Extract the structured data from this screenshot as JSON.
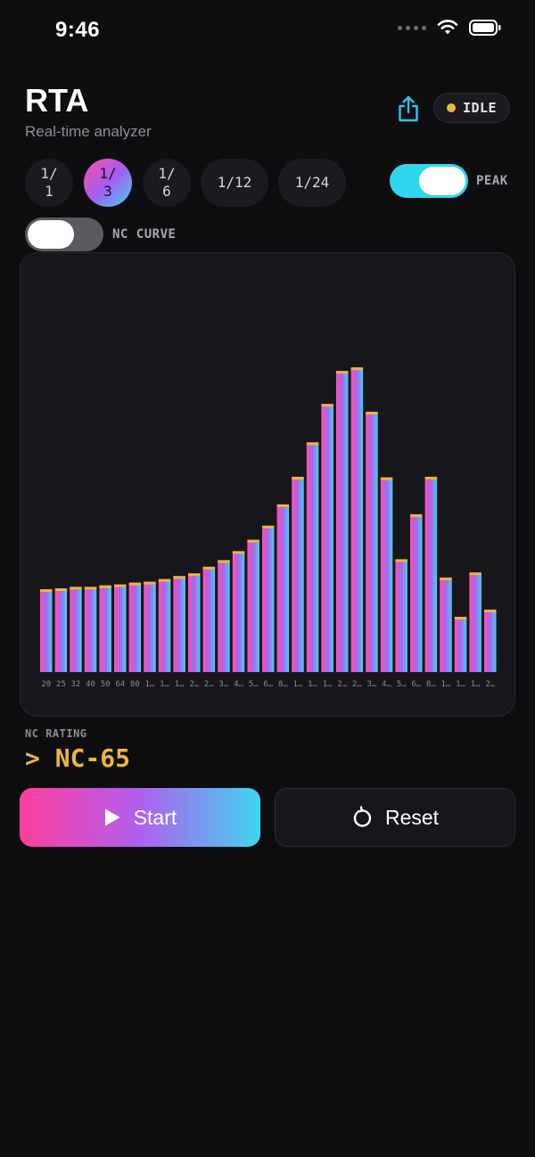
{
  "status_bar": {
    "time": "9:46"
  },
  "header": {
    "title": "RTA",
    "subtitle": "Real-time analyzer",
    "status_badge": "IDLE",
    "badge_color": "#f0b43c"
  },
  "resolution": {
    "options": [
      "1/\n1",
      "1/\n3",
      "1/\n6",
      "1/12",
      "1/24"
    ],
    "selected": "1/\n3"
  },
  "toggles": {
    "peak": {
      "label": "PEAK",
      "on": true
    },
    "nc_curve": {
      "label": "NC CURVE",
      "on": false
    }
  },
  "chart_data": {
    "type": "bar",
    "categories": [
      "20",
      "25",
      "32",
      "40",
      "50",
      "64",
      "80",
      "1…",
      "1…",
      "1…",
      "2…",
      "2…",
      "3…",
      "4…",
      "5…",
      "6…",
      "8…",
      "1…",
      "1…",
      "1…",
      "2…",
      "2…",
      "3…",
      "4…",
      "5…",
      "6…",
      "8…",
      "1…",
      "1…",
      "1…",
      "2…"
    ],
    "values": [
      0.272,
      0.275,
      0.28,
      0.28,
      0.285,
      0.288,
      0.294,
      0.297,
      0.306,
      0.316,
      0.325,
      0.347,
      0.369,
      0.399,
      0.437,
      0.484,
      0.555,
      0.647,
      0.762,
      0.89,
      1.0,
      1.012,
      0.864,
      0.645,
      0.372,
      0.522,
      0.647,
      0.311,
      0.18,
      0.328,
      0.204
    ],
    "peak_hold": true,
    "ylim": [
      0,
      1.1
    ],
    "colors": {
      "bar_start": "#ff4fb0",
      "bar_mid": "#a865f0",
      "bar_end": "#44d0f0",
      "peak_marker": "#f0b43c"
    }
  },
  "nc_rating": {
    "label": "NC RATING",
    "value": "> NC-65"
  },
  "actions": {
    "start_label": "Start",
    "reset_label": "Reset"
  }
}
